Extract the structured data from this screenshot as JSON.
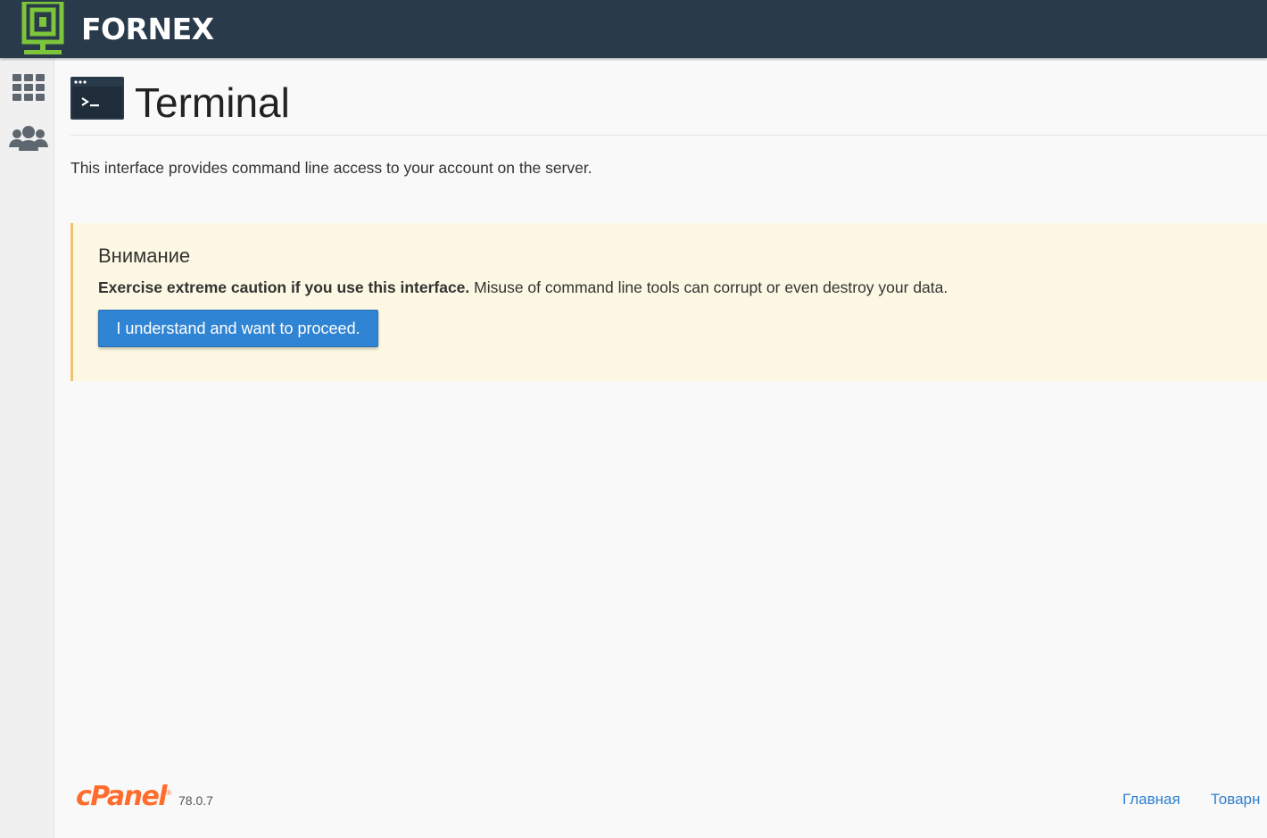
{
  "brand": {
    "name": "FORNEX",
    "logo_color": "#7dc53a",
    "header_bg": "#293a4a"
  },
  "sidebar": {
    "items": [
      {
        "icon": "grid-apps-icon",
        "label": ""
      },
      {
        "icon": "users-group-icon",
        "label": ""
      }
    ]
  },
  "page": {
    "title": "Terminal",
    "icon": "terminal-icon",
    "description": "This interface provides command line access to your account on the server."
  },
  "alert": {
    "title": "Внимание",
    "bold_text": "Exercise extreme caution if you use this interface.",
    "text": " Misuse of command line tools can corrupt or even destroy your data.",
    "button_label": "I understand and want to proceed.",
    "bg_color": "#fcf8e3",
    "button_color": "#3084d4"
  },
  "footer": {
    "logo_text": "cPanel",
    "version": "78.0.7",
    "links": [
      "Главная",
      "Товарн"
    ],
    "logo_color": "#ff6c2c"
  }
}
